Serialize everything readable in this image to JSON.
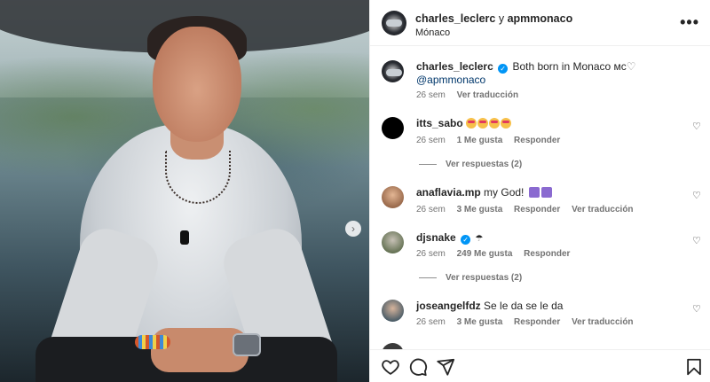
{
  "post": {
    "author": "charles_leclerc",
    "joiner": "y",
    "collaborator": "apmmonaco",
    "location": "Mónaco",
    "more_label": "•••"
  },
  "caption": {
    "user": "charles_leclerc",
    "text": "Both born in Monaco",
    "suffix": "мс",
    "mention": "@apmmonaco",
    "time": "26 sem",
    "translate": "Ver traducción"
  },
  "comments": [
    {
      "user": "itts_sabo",
      "text": "",
      "emoji_count": 4,
      "time": "26 sem",
      "likes": "1 Me gusta",
      "reply": "Responder",
      "translate": "",
      "view_replies": "Ver respuestas (2)"
    },
    {
      "user": "anaflavia.mp",
      "text": "my God!",
      "emoji_count": 0,
      "time": "26 sem",
      "likes": "3 Me gusta",
      "reply": "Responder",
      "translate": "Ver traducción",
      "view_replies": ""
    },
    {
      "user": "djsnake",
      "text": "",
      "emoji_count": 0,
      "time": "26 sem",
      "likes": "249 Me gusta",
      "reply": "Responder",
      "translate": "",
      "view_replies": "Ver respuestas (2)"
    },
    {
      "user": "joseangelfdz",
      "text": "Se le da se le da",
      "emoji_count": 0,
      "time": "26 sem",
      "likes": "3 Me gusta",
      "reply": "Responder",
      "translate": "Ver traducción",
      "view_replies": ""
    }
  ],
  "icons": {
    "like": "heart-icon",
    "comment": "comment-icon",
    "share": "share-icon",
    "save": "bookmark-icon",
    "next": "chevron-right-icon"
  },
  "colors": {
    "verified": "#0095f6",
    "meta": "#737373",
    "text": "#262626"
  }
}
